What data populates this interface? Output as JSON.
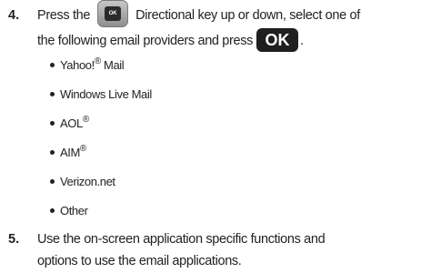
{
  "step4": {
    "number": "4.",
    "line1_before": "Press the",
    "nav_key_label": "OK",
    "line1_after": "Directional key up or down, select one of",
    "line2_text": "the following email providers and press",
    "ok_key_label": "OK",
    "line2_end": "."
  },
  "providers": [
    {
      "name": "Yahoo!",
      "sup": "®",
      "suffix": " Mail"
    },
    {
      "name": "Windows Live Mail",
      "sup": "",
      "suffix": ""
    },
    {
      "name": "AOL",
      "sup": "®",
      "suffix": ""
    },
    {
      "name": "AIM",
      "sup": "®",
      "suffix": ""
    },
    {
      "name": "Verizon.net",
      "sup": "",
      "suffix": ""
    },
    {
      "name": "Other",
      "sup": "",
      "suffix": ""
    }
  ],
  "step5": {
    "number": "5.",
    "line1": "Use the on-screen application specific functions and",
    "line2": "options to use the email applications."
  }
}
